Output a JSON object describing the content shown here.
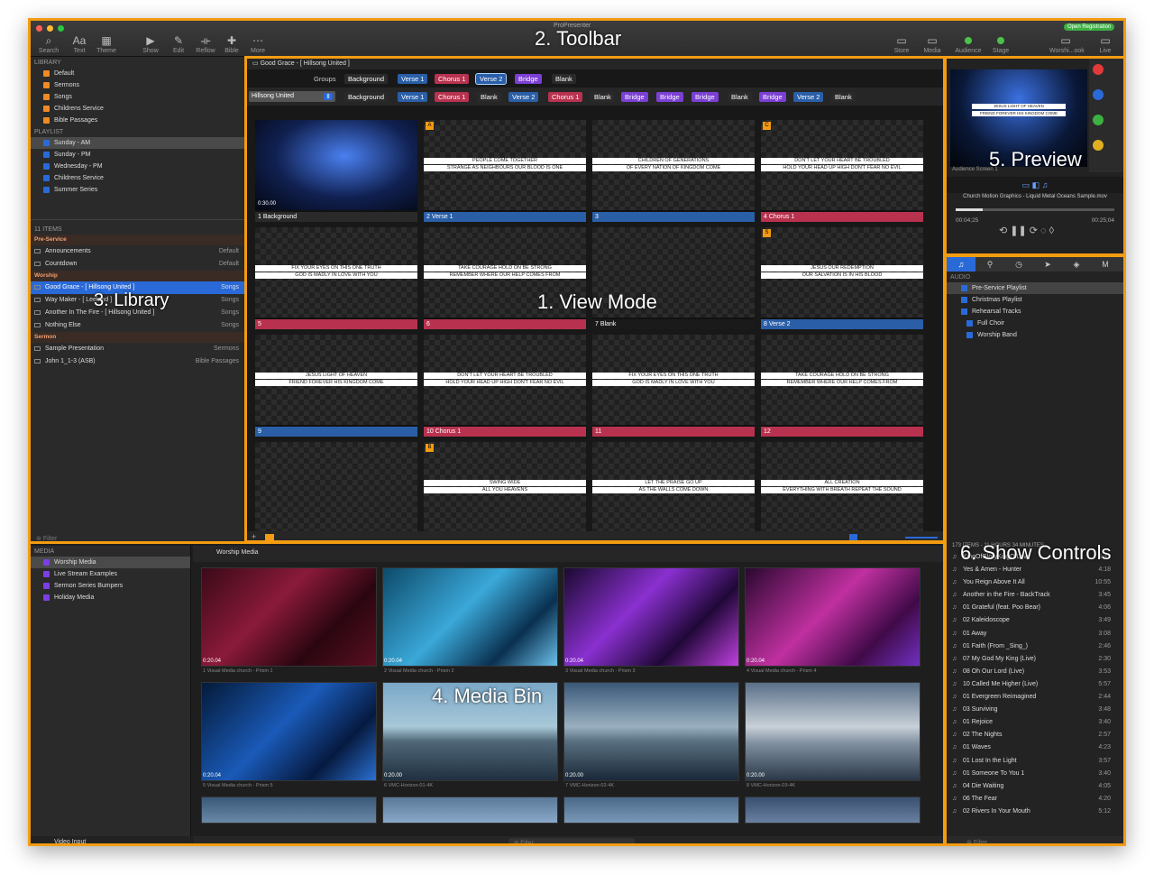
{
  "app": {
    "title": "ProPresenter",
    "registration": "Open Registration"
  },
  "toolbar": {
    "left": [
      {
        "label": "Search",
        "icon": "search-icon"
      },
      {
        "label": "Text",
        "icon": "text-icon"
      },
      {
        "label": "Theme",
        "icon": "theme-icon"
      },
      {
        "label": "Show",
        "icon": "play-icon"
      },
      {
        "label": "Edit",
        "icon": "pencil-icon"
      },
      {
        "label": "Reflow",
        "icon": "reflow-icon"
      },
      {
        "label": "Bible",
        "icon": "bible-icon"
      },
      {
        "label": "More",
        "icon": "more-icon"
      }
    ],
    "right": [
      {
        "label": "Store"
      },
      {
        "label": "Media"
      },
      {
        "label": "Audience"
      },
      {
        "label": "Stage"
      },
      {
        "label": "Worshi...ook"
      },
      {
        "label": "Live"
      }
    ]
  },
  "annotations": {
    "toolbar": "2. Toolbar",
    "view": "1. View Mode",
    "library": "3. Library",
    "media": "4. Media Bin",
    "preview": "5. Preview",
    "controls": "6. Show Controls"
  },
  "library": {
    "library_header": "LIBRARY",
    "libraries": [
      "Default",
      "Sermons",
      "Songs",
      "Childrens Service",
      "Bible Passages"
    ],
    "playlist_header": "PLAYLIST",
    "playlists": [
      "Sunday - AM",
      "Sunday - PM",
      "Wednesday - PM",
      "Childrens Service",
      "Summer Series"
    ],
    "items_count": "11 ITEMS",
    "groups": [
      {
        "name": "Pre-Service",
        "items": [
          {
            "name": "Announcements",
            "type": "Default"
          },
          {
            "name": "Countdown",
            "type": "Default"
          }
        ]
      },
      {
        "name": "Worship",
        "items": [
          {
            "name": "Good Grace - [ Hillsong United ]",
            "type": "Songs"
          },
          {
            "name": "Way Maker - [ Leeland ]",
            "type": "Songs"
          },
          {
            "name": "Another In The Fire - [ Hillsong United ]",
            "type": "Songs"
          },
          {
            "name": "Nothing Else",
            "type": "Songs"
          }
        ]
      },
      {
        "name": "Sermon",
        "items": [
          {
            "name": "Sample Presentation",
            "type": "Sermons"
          },
          {
            "name": "John 1_1-3 (ASB)",
            "type": "Bible Passages"
          }
        ]
      }
    ],
    "filter": "Filter"
  },
  "view": {
    "title": "Good Grace - [ Hillsong United ]",
    "groups_label": "Groups",
    "groups": [
      {
        "name": "Background",
        "color": "#2a2a2a"
      },
      {
        "name": "Verse 1",
        "color": "#2a5fa8"
      },
      {
        "name": "Chorus 1",
        "color": "#b8324f"
      },
      {
        "name": "Verse 2",
        "color": "#2a5fa8"
      },
      {
        "name": "Bridge",
        "color": "#7b3fd4"
      },
      {
        "name": "Blank",
        "color": "#2a2a2a"
      }
    ],
    "arrangement_name": "Hillsong United",
    "arrangement": [
      {
        "name": "Background",
        "color": "#2a2a2a"
      },
      {
        "name": "Verse 1",
        "color": "#2a5fa8"
      },
      {
        "name": "Chorus 1",
        "color": "#b8324f"
      },
      {
        "name": "Blank",
        "color": "#2a2a2a"
      },
      {
        "name": "Verse 2",
        "color": "#2a5fa8"
      },
      {
        "name": "Chorus 1",
        "color": "#b8324f"
      },
      {
        "name": "Blank",
        "color": "#2a2a2a"
      },
      {
        "name": "Bridge",
        "color": "#7b3fd4"
      },
      {
        "name": "Bridge",
        "color": "#7b3fd4"
      },
      {
        "name": "Bridge",
        "color": "#7b3fd4"
      },
      {
        "name": "Blank",
        "color": "#2a2a2a"
      },
      {
        "name": "Bridge",
        "color": "#7b3fd4"
      },
      {
        "name": "Verse 2",
        "color": "#2a5fa8"
      },
      {
        "name": "Blank",
        "color": "#2a2a2a"
      }
    ],
    "slides": [
      {
        "label": "1 Background",
        "color": "#2a2a2a",
        "l1": "",
        "l2": "",
        "badge": "",
        "time": "0:30.00",
        "bg": true
      },
      {
        "label": "2 Verse 1",
        "color": "#2a5fa8",
        "l1": "PEOPLE COME TOGETHER",
        "l2": "STRANGE AS NEIGHBOURS OUR BLOOD IS ONE",
        "badge": "A"
      },
      {
        "label": "3",
        "color": "#2a5fa8",
        "l1": "CHILDREN OF GENERATIONS",
        "l2": "OF EVERY NATION OF KINGDOM COME",
        "badge": ""
      },
      {
        "label": "4 Chorus 1",
        "color": "#b8324f",
        "l1": "DON'T LET YOUR HEART BE TROUBLED",
        "l2": "HOLD YOUR HEAD UP HIGH DON'T FEAR NO EVIL",
        "badge": "C"
      },
      {
        "label": "5",
        "color": "#b8324f",
        "l1": "FIX YOUR EYES ON THIS ONE TRUTH",
        "l2": "GOD IS MADLY IN LOVE WITH YOU",
        "badge": ""
      },
      {
        "label": "6",
        "color": "#b8324f",
        "l1": "TAKE COURAGE HOLD ON BE STRONG",
        "l2": "REMEMBER WHERE OUR HELP COMES FROM",
        "badge": ""
      },
      {
        "label": "7 Blank",
        "color": "#1a1a1a",
        "l1": "",
        "l2": "",
        "badge": ""
      },
      {
        "label": "8 Verse 2",
        "color": "#2a5fa8",
        "l1": "JESUS OUR REDEMPTION",
        "l2": "OUR SALVATION IS IN HIS BLOOD",
        "badge": "S"
      },
      {
        "label": "9",
        "color": "#2a5fa8",
        "l1": "JESUS LIGHT OF HEAVEN",
        "l2": "FRIEND FOREVER HIS KINGDOM COME",
        "badge": ""
      },
      {
        "label": "10 Chorus 1",
        "color": "#b8324f",
        "l1": "DON'T LET YOUR HEART BE TROUBLED",
        "l2": "HOLD YOUR HEAD UP HIGH DON'T FEAR NO EVIL",
        "badge": ""
      },
      {
        "label": "11",
        "color": "#b8324f",
        "l1": "FIX YOUR EYES ON THIS ONE TRUTH",
        "l2": "GOD IS MADLY IN LOVE WITH YOU",
        "badge": ""
      },
      {
        "label": "12",
        "color": "#b8324f",
        "l1": "TAKE COURAGE HOLD ON BE STRONG",
        "l2": "REMEMBER WHERE OUR HELP COMES FROM",
        "badge": ""
      },
      {
        "label": "",
        "color": "#1a1a1a",
        "l1": "",
        "l2": "",
        "badge": ""
      },
      {
        "label": "",
        "color": "#1a1a1a",
        "l1": "SWING WIDE",
        "l2": "ALL YOU HEAVENS",
        "badge": "B"
      },
      {
        "label": "",
        "color": "#1a1a1a",
        "l1": "LET THE PRAISE GO UP",
        "l2": "AS THE WALLS COME DOWN",
        "badge": ""
      },
      {
        "label": "",
        "color": "#1a1a1a",
        "l1": "ALL CREATION",
        "l2": "EVERYTHING WITH BREATH REPEAT THE SOUND",
        "badge": ""
      }
    ]
  },
  "preview": {
    "l1": "JESUS LIGHT OF HEAVEN",
    "l2": "FRIEND FOREVER HIS KINGDOM COME",
    "screen": "Audience Screen 1",
    "media_name": "Church Motion Graphics - Liquid Metal Oceans Sample.mov",
    "elapsed": "00:04;25",
    "total": "00:25;04",
    "progress": 0.17
  },
  "controls": {
    "audio_header": "AUDIO",
    "playlists": [
      "Pre-Service Playlist",
      "Christmas Playlist",
      "Rehearsal Tracks",
      "Full Choir",
      "Worship Band"
    ],
    "summary": "173 ITEMS - 11 HOURS 34 MINUTES",
    "tracks": [
      {
        "name": "KingOfGloryKingOfLove",
        "time": "3:42"
      },
      {
        "name": "Yes & Amen - Hunter",
        "time": "4:18"
      },
      {
        "name": "You Reign Above It All",
        "time": "10:55"
      },
      {
        "name": "Another in the Fire - BackTrack",
        "time": "3:45"
      },
      {
        "name": "01 Grateful (feat. Poo Bear)",
        "time": "4:06"
      },
      {
        "name": "02 Kaleidoscope",
        "time": "3:49"
      },
      {
        "name": "01 Away",
        "time": "3:08"
      },
      {
        "name": "01 Faith (From _Sing_)",
        "time": "2:46"
      },
      {
        "name": "07 My God My King (Live)",
        "time": "2:30"
      },
      {
        "name": "08 Oh Our Lord (Live)",
        "time": "3:53"
      },
      {
        "name": "10 Called Me Higher (Live)",
        "time": "5:57"
      },
      {
        "name": "01 Evergreen Reimagined",
        "time": "2:44"
      },
      {
        "name": "03 Surviving",
        "time": "3:48"
      },
      {
        "name": "01 Rejoice",
        "time": "3:40"
      },
      {
        "name": "02 The Nights",
        "time": "2:57"
      },
      {
        "name": "01 Waves",
        "time": "4:23"
      },
      {
        "name": "01 Lost In the Light",
        "time": "3:57"
      },
      {
        "name": "01 Someone To You 1",
        "time": "3:40"
      },
      {
        "name": "04 Die Waiting",
        "time": "4:05"
      },
      {
        "name": "06 The Fear",
        "time": "4:20"
      },
      {
        "name": "02 Rivers In Your Mouth",
        "time": "5:12"
      }
    ],
    "filter": "Filter"
  },
  "media": {
    "header": "MEDIA",
    "items": [
      "Worship Media",
      "Live Stream Examples",
      "Sermon Series Bumpers",
      "Holiday Media"
    ],
    "video_input": "Video Input",
    "bin_title": "Worship Media",
    "filter": "Filter",
    "thumbs": [
      {
        "name": "1 Visual Media church - Prism 1",
        "dur": "0:20.04",
        "bg": "linear-gradient(135deg,#3a0a18,#8b1a3a 40%,#2a0610 70%,#5a0f20)"
      },
      {
        "name": "2 Visual Media church - Prism 2",
        "dur": "0:20.04",
        "bg": "linear-gradient(135deg,#0d4a6a,#3aa8d8 45%,#0a3050 75%,#6ac0e8)"
      },
      {
        "name": "3 Visual Media church - Prism 3",
        "dur": "0:20.04",
        "bg": "linear-gradient(135deg,#1a0a30,#8a30d0 40%,#200838 70%,#c040e0)"
      },
      {
        "name": "4 Visual Media church - Prism 4",
        "dur": "0:20.04",
        "bg": "linear-gradient(135deg,#2a0830,#c030a0 45%,#400a48 75%,#7030c0)"
      },
      {
        "name": "5 Visual Media church - Prism 5",
        "dur": "0:20.04",
        "bg": "linear-gradient(135deg,#041a38,#1a5ab8 45%,#061a40 75%,#2a70d0)"
      },
      {
        "name": "6 VMC-Horizon-01-4K",
        "dur": "0:20.00",
        "bg": "linear-gradient(#7aa8c8,#a8c8d8 45%,#506878 60%,#203040)"
      },
      {
        "name": "7 VMC-Horizon-02-4K",
        "dur": "0:20.00",
        "bg": "linear-gradient(#3a5878,#9ab0c0 45%,#587080 60%,#1a2838)"
      },
      {
        "name": "8 VMC-Horizon-03-4K",
        "dur": "0:20.00",
        "bg": "linear-gradient(#5a7088,#c8d0d8 45%,#8090a0 62%,#2a3848)"
      },
      {
        "name": "",
        "dur": "",
        "bg": "linear-gradient(#3a5878,#6a88a8)"
      },
      {
        "name": "",
        "dur": "",
        "bg": "linear-gradient(#5a7898,#8aa8c8)"
      },
      {
        "name": "",
        "dur": "",
        "bg": "linear-gradient(#4a6888,#7a98b8)"
      },
      {
        "name": "",
        "dur": "",
        "bg": "linear-gradient(#3a5070,#6a80a0)"
      }
    ]
  }
}
